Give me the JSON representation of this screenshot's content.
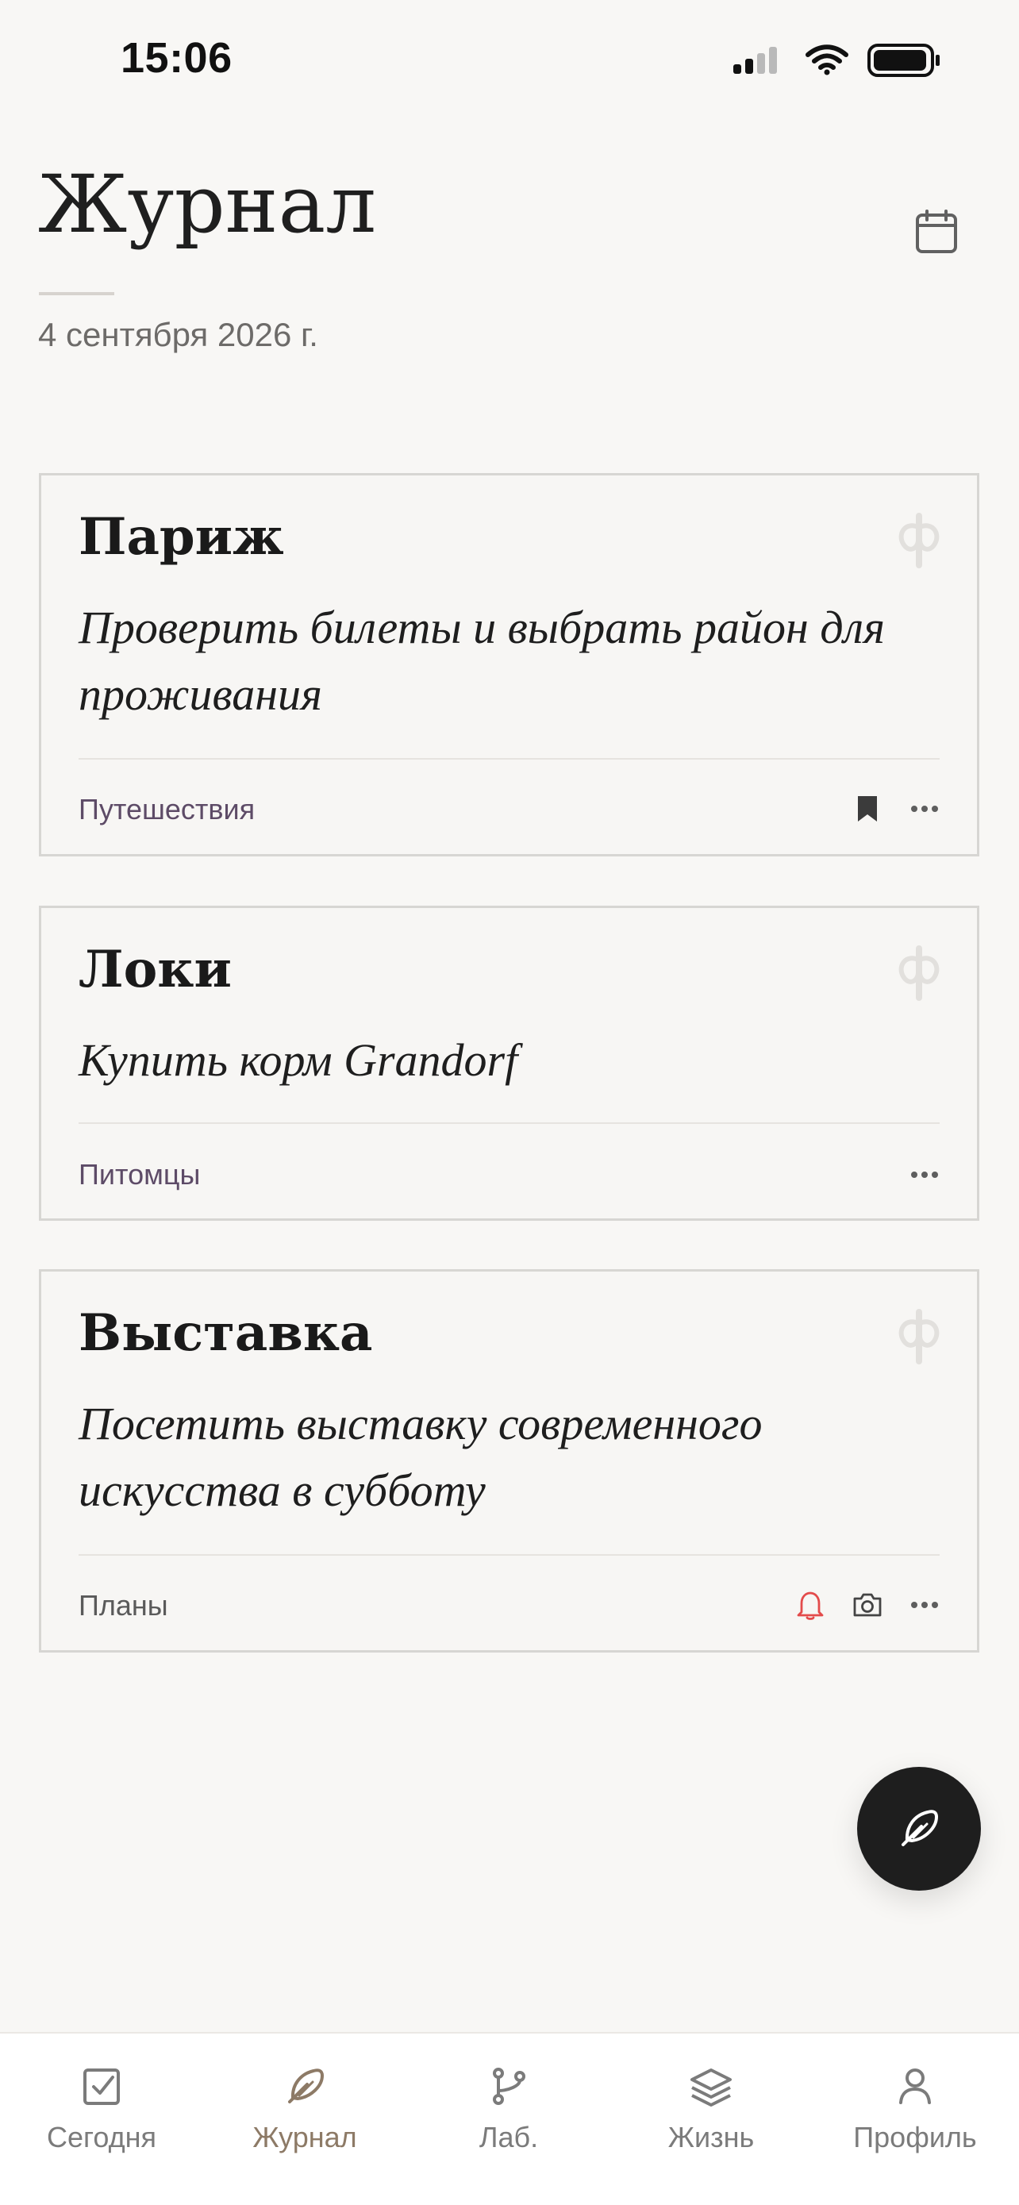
{
  "status_bar": {
    "time": "15:06",
    "signal_icon": "signal-icon",
    "wifi_icon": "wifi-icon",
    "battery_icon": "battery-icon"
  },
  "header": {
    "title": "Журнал",
    "date": "4 сентября 2026 г.",
    "calendar_icon": "calendar-icon"
  },
  "cards": [
    {
      "title": "Париж",
      "text": "Проверить билеты и выбрать район для проживания",
      "tag": "Путешествия",
      "watermark_icon": "phi-symbol-icon",
      "actions": [
        "bookmark-icon",
        "more-icon"
      ]
    },
    {
      "title": "Локи",
      "text": "Купить корм Grandorf",
      "tag": "Питомцы",
      "watermark_icon": "phi-symbol-icon",
      "actions": [
        "more-icon"
      ]
    },
    {
      "title": "Выставка",
      "text": "Посетить выставку современного искусства в субботу",
      "tag": "Планы",
      "watermark_icon": "phi-symbol-icon",
      "actions": [
        "bell-icon",
        "camera-icon",
        "more-icon"
      ]
    }
  ],
  "fab": {
    "icon": "feather-icon"
  },
  "tab_bar": {
    "items": [
      {
        "label": "Сегодня",
        "icon": "checkbox-icon",
        "active": false
      },
      {
        "label": "Журнал",
        "icon": "feather-icon",
        "active": true
      },
      {
        "label": "Лаб.",
        "icon": "branch-icon",
        "active": false
      },
      {
        "label": "Жизнь",
        "icon": "layers-icon",
        "active": false
      },
      {
        "label": "Профиль",
        "icon": "user-icon",
        "active": false
      }
    ]
  },
  "colors": {
    "background": "#f8f7f5",
    "card_border": "#d7d6d3",
    "accent_tag": "#5d4b67",
    "active_tab": "#8d7a66",
    "alert_bell": "#e34b4b",
    "fab_background": "#1e1e1e"
  }
}
